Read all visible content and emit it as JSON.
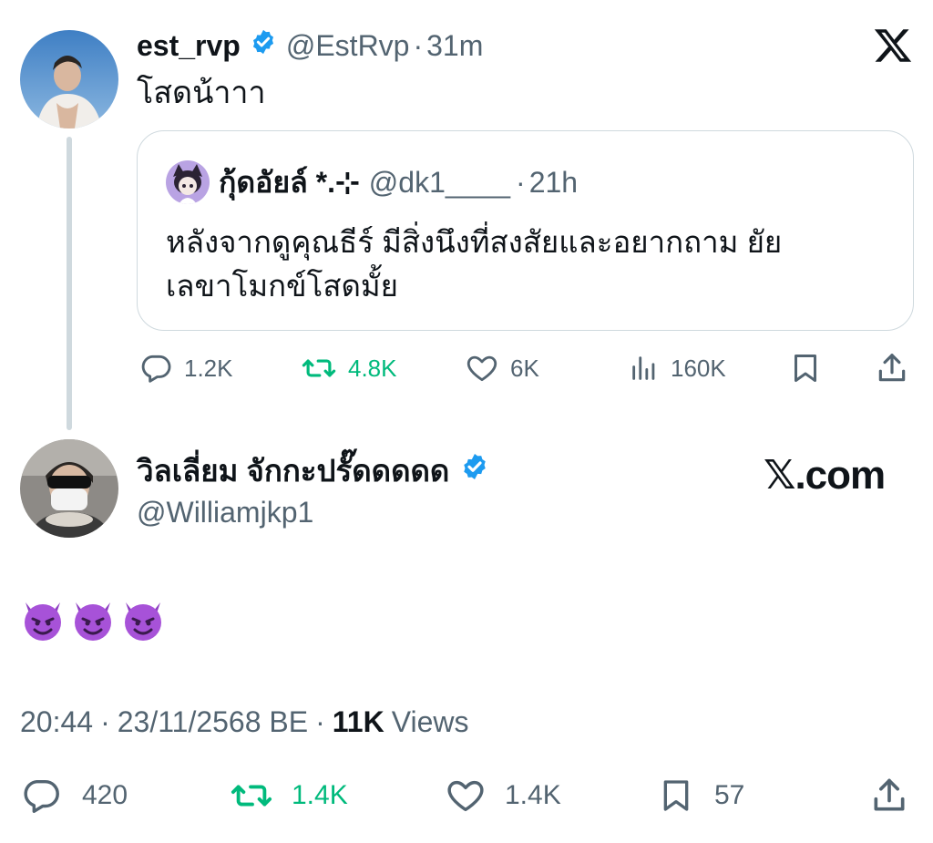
{
  "tweet1": {
    "name": "est_rvp",
    "handle": "@EstRvp",
    "sep": "·",
    "time": "31m",
    "text": "โสดน้าาา"
  },
  "quote": {
    "name": "กุ้ดอัยล์ *.⊹",
    "handle": "@dk1____",
    "sep": "·",
    "time": "21h",
    "text_line1": "หลังจากดูคุณธีร์ มีสิ่งนึงที่สงสัยและอยากถาม ยัย",
    "text_line2": "เลขาโมกข์โสดมั้ย"
  },
  "tweet1_actions": {
    "replies": "1.2K",
    "reposts": "4.8K",
    "likes": "6K",
    "views": "160K"
  },
  "tweet2": {
    "name": "วิลเลี่ยม จักกะปรั๊ดดดดด",
    "handle": "@Williamjkp1",
    "watermark": "𝕏.com",
    "emojis": [
      "smiling-imp",
      "smiling-imp",
      "smiling-imp"
    ],
    "time": "20:44",
    "sep": "·",
    "date": "23/11/2568 BE",
    "views_count": "11K",
    "views_label": "Views"
  },
  "tweet2_actions": {
    "replies": "420",
    "reposts": "1.4K",
    "likes": "1.4K",
    "bookmarks": "57"
  },
  "colors": {
    "verified": "#1d9bf0",
    "repost_green": "#00ba7c",
    "muted": "#536471",
    "border": "#cfd9de"
  }
}
